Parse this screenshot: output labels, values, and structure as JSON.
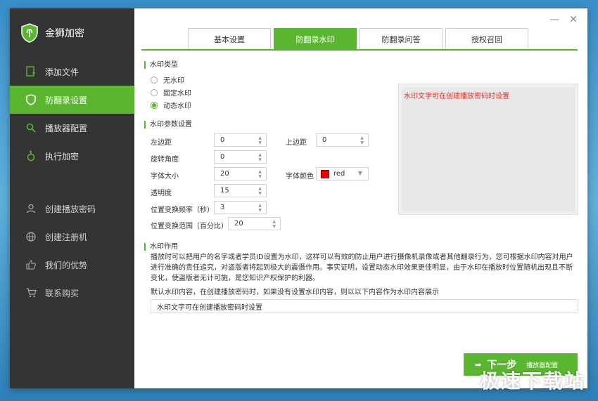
{
  "app": {
    "title": "金狮加密"
  },
  "window_controls": {
    "minimize": "—",
    "close": "✕"
  },
  "sidebar": {
    "items": [
      {
        "label": "添加文件",
        "icon": "add-file-icon"
      },
      {
        "label": "防翻录设置",
        "icon": "shield-icon",
        "active": true
      },
      {
        "label": "播放器配置",
        "icon": "search-icon"
      },
      {
        "label": "执行加密",
        "icon": "lock-icon"
      }
    ],
    "items2": [
      {
        "label": "创建播放密码",
        "icon": "user-icon"
      },
      {
        "label": "创建注册机",
        "icon": "globe-icon"
      },
      {
        "label": "我们的优势",
        "icon": "thumbs-up-icon"
      },
      {
        "label": "联系购买",
        "icon": "cart-icon"
      }
    ]
  },
  "tabs": [
    {
      "label": "基本设置"
    },
    {
      "label": "防翻录水印",
      "active": true
    },
    {
      "label": "防翻录问答"
    },
    {
      "label": "授权召回"
    }
  ],
  "watermark_type": {
    "title": "水印类型",
    "options": [
      "无水印",
      "固定水印",
      "动态水印"
    ],
    "selected": "动态水印"
  },
  "params": {
    "title": "水印参数设置",
    "left_margin_label": "左边距",
    "left_margin": "0",
    "top_margin_label": "上边距",
    "top_margin": "0",
    "rotation_label": "旋转角度",
    "rotation": "0",
    "font_size_label": "字体大小",
    "font_size": "20",
    "font_color_label": "字体颜色",
    "font_color": "red",
    "opacity_label": "透明度",
    "opacity": "15",
    "freq_label": "位置变换频率（秒）",
    "freq": "3",
    "range_label": "位置变换范围（百分比）",
    "range": "20"
  },
  "preview": {
    "text": "水印文字可在创建播放密码时设置"
  },
  "effect": {
    "title": "水印作用",
    "description": "播放时可以把用户的名字或者学员ID设置为水印，这样可以有效的防止用户进行摄像机录像或者其他翻录行为，您可根据水印内容对用户进行准确的责任追究，对盗版者将起到极大的震慑作用。事实证明，设置动态水印效果更佳明显，由于水印在播放时位置随机出现且不断变化，使盗版者无计可施，是您知识产权保护的利器。",
    "default_note": "默认水印内容，在创建播放密码时，如果没有设置水印内容，则以以下内容作为水印内容展示",
    "default_value": "水印文字可在创建播放密码时设置"
  },
  "next_button": {
    "label": "下一步",
    "sub": "播放器配置"
  },
  "site_watermark": "极速下载站",
  "colors": {
    "accent": "#5cb531",
    "sidebar_bg": "#343434",
    "preview_text": "#e03030"
  }
}
